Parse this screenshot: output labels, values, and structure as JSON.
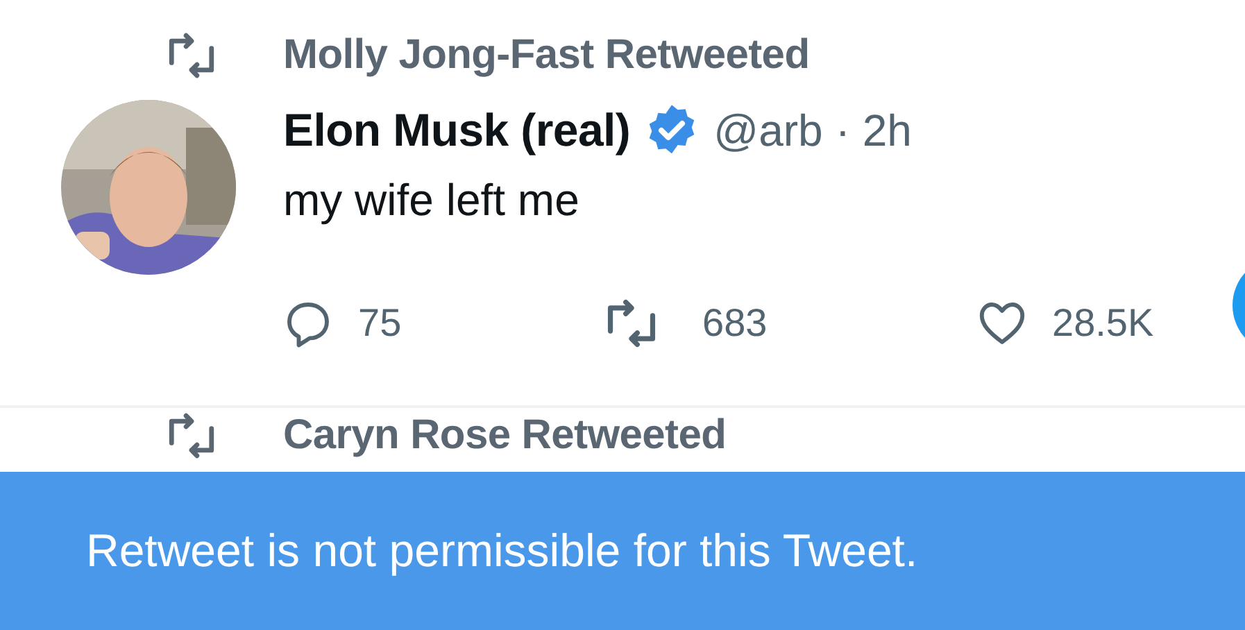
{
  "tweet": {
    "retweeted_by": "Molly Jong-Fast Retweeted",
    "author_name": "Elon Musk (real)",
    "verified": true,
    "handle": "@arb",
    "time": "· 2h",
    "text": "my wife left me",
    "stats": [
      {
        "kind": "reply",
        "count": "75"
      },
      {
        "kind": "retweet",
        "count": "683"
      },
      {
        "kind": "like",
        "count": "28.5K"
      }
    ]
  },
  "next_tweet": {
    "retweeted_by": "Caryn Rose Retweeted"
  },
  "toast": {
    "message": "Retweet is not permissible for this Tweet."
  }
}
